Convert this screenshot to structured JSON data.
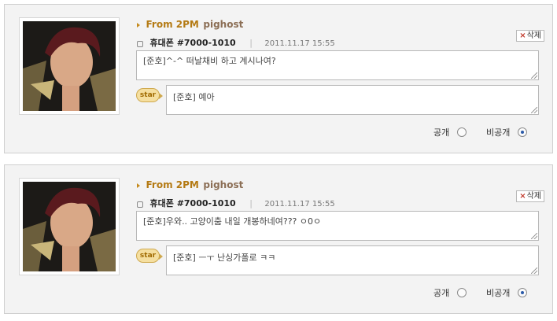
{
  "comments": [
    {
      "from_label": "From 2PM",
      "nickname": "pighost",
      "phone": "휴대폰 #7000-1010",
      "separator": "|",
      "date": "2011.11.17 15:55",
      "delete_label": "삭제",
      "message": "[준호]^-^ 떠날채비 하고 계시나여?",
      "star_label": "star",
      "reply": "[준호] 예아",
      "public_label": "공개",
      "private_label": "비공개",
      "visibility": "private"
    },
    {
      "from_label": "From 2PM",
      "nickname": "pighost",
      "phone": "휴대폰 #7000-1010",
      "separator": "|",
      "date": "2011.11.17 15:55",
      "delete_label": "삭제",
      "message": "[준호]우와.. 고양이춤 내일 개봉하네여??? ㅇ0ㅇ",
      "star_label": "star",
      "reply": "[준호] ㅡㅜ 난싱가폴로 ㅋㅋ",
      "public_label": "공개",
      "private_label": "비공개",
      "visibility": "private"
    }
  ],
  "colors": {
    "accent": "#b47a13",
    "nickname": "#8b6e55",
    "radio_on": "#2b5aa8"
  }
}
